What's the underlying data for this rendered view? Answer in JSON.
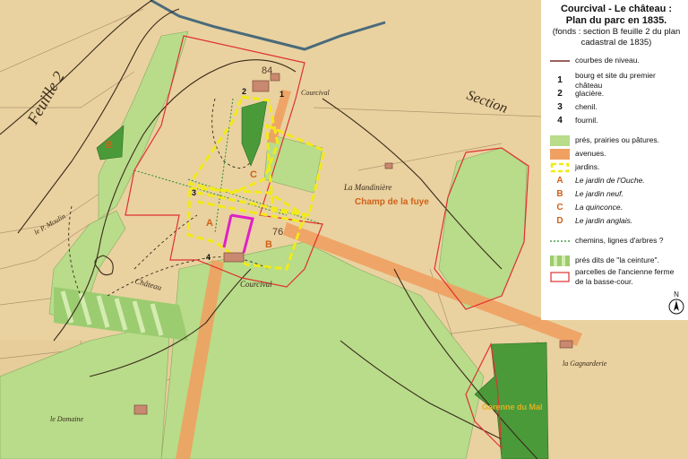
{
  "title_line1": "Courcival - Le château :",
  "title_line2": "Plan du parc en 1835.",
  "subtitle": "(fonds : section B feuille 2 du plan cadastral de 1835)",
  "legend": {
    "contours": "courbes de niveau.",
    "num1": "1",
    "item1": "bourg et site du premier château",
    "num2": "2",
    "item2": "glacière.",
    "num3": "3",
    "item3": "chenil.",
    "num4": "4",
    "item4": "fournil.",
    "meadows": "prés, prairies ou pâtures.",
    "avenues": "avenues.",
    "gardens": "jardins.",
    "letA": "A",
    "gardenA": "Le jardin de l'Ouche.",
    "letB": "B",
    "gardenB": "Le jardin neuf.",
    "letC": "C",
    "gardenC": "La quinconce.",
    "letD": "D",
    "gardenD": "Le jardin anglais.",
    "paths": "chemins, lignes d'arbres ?",
    "belt": "prés dits de \"la ceinture\".",
    "farm": "parcelles de l'ancienne ferme de la basse-cour.",
    "north": "N"
  },
  "map_labels": {
    "champ": "Champ de la fuye",
    "garenne": "Garenne du Mal",
    "n84": "84",
    "n76": "76",
    "mA": "A",
    "mB": "B",
    "mC": "C",
    "mD": "D",
    "m1": "1",
    "m2": "2",
    "m3": "3",
    "m4": "4",
    "courcival1": "Courcival",
    "courcival2": "Courcival",
    "mandiniere": "La Mandinière",
    "chateau": "Château",
    "domaine": "le Domaine",
    "moulin": "le P. Moulin",
    "feuille": "Feuille 2",
    "gagnarderie": "la Gagnarderie",
    "section": "Section"
  },
  "colors": {
    "paper": "#e9d2a0",
    "meadow": "#b8dc8a",
    "wood": "#4a9a3a",
    "avenue": "#f0a060",
    "garden_outline": "#f2ea18",
    "contour": "#3a2a1a",
    "farm_outline": "#e03030",
    "magenta": "#e020c8",
    "river": "#4a6a7a"
  },
  "icons": {
    "north": "north-arrow-icon"
  }
}
